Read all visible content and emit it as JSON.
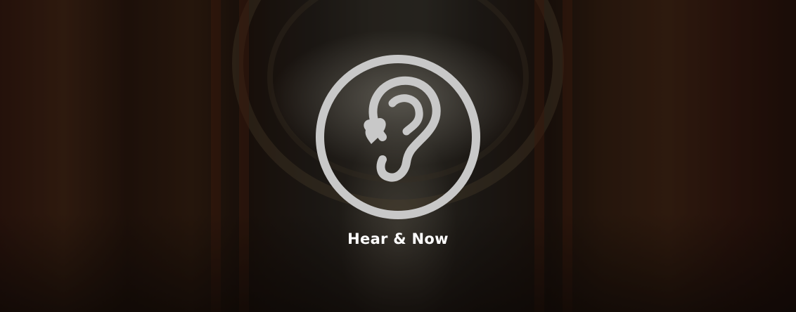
{
  "hero": {
    "brand_name": "Hear & Now",
    "logo_icon": "ear-heart-icon",
    "logo_color": "#c8c8c8",
    "text_color": "#ffffff"
  }
}
